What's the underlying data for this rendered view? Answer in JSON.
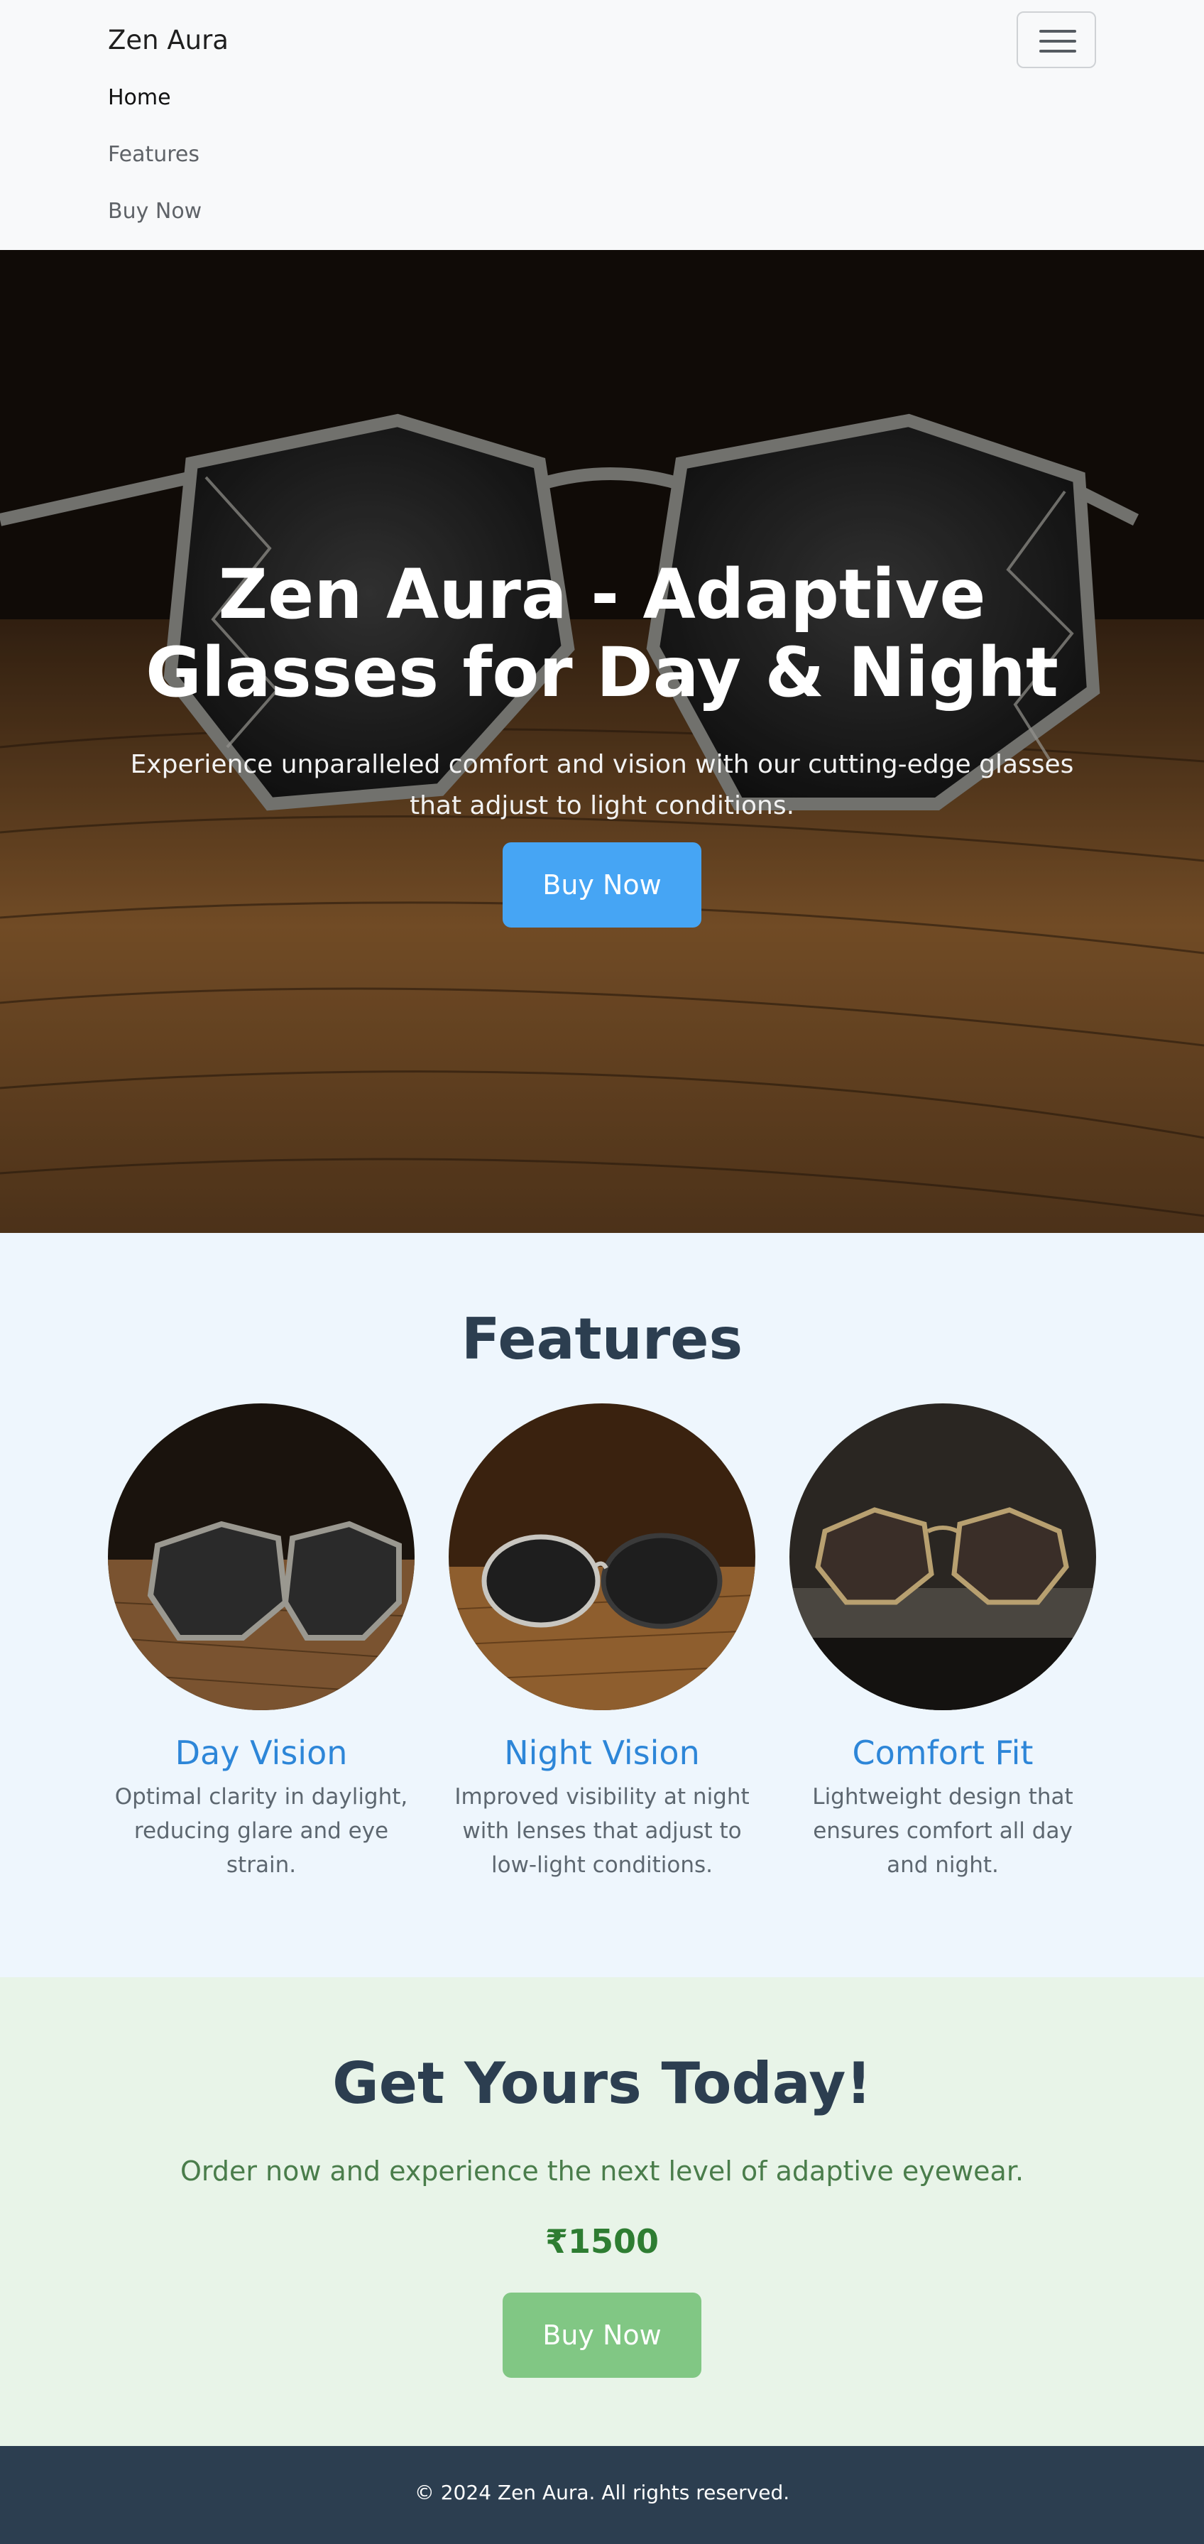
{
  "navbar": {
    "brand": "Zen Aura",
    "toggle_icon": "hamburger-menu-icon",
    "links": [
      {
        "label": "Home",
        "active": true
      },
      {
        "label": "Features",
        "active": false
      },
      {
        "label": "Buy Now",
        "active": false
      }
    ]
  },
  "hero": {
    "title": "Zen Aura - Adaptive Glasses for Day & Night",
    "subtitle": "Experience unparalleled comfort and vision with our cutting-edge glasses that adjust to light conditions.",
    "button_label": "Buy Now",
    "background": "photo of geometric metal-frame sunglasses on a wooden table"
  },
  "features": {
    "title": "Features",
    "items": [
      {
        "name": "Day Vision",
        "description": "Optimal clarity in daylight, reducing glare and eye strain."
      },
      {
        "name": "Night Vision",
        "description": "Improved visibility at night with lenses that adjust to low-light conditions."
      },
      {
        "name": "Comfort Fit",
        "description": "Lightweight design that ensures comfort all day and night."
      }
    ]
  },
  "cta": {
    "title": "Get Yours Today!",
    "subtitle": "Order now and experience the next level of adaptive eyewear.",
    "price": "₹1500",
    "button_label": "Buy Now"
  },
  "footer": {
    "text": "© 2024 Zen Aura. All rights reserved."
  },
  "colors": {
    "primary_button": "#46a5f4",
    "cta_button": "#81c784",
    "feature_heading": "#2d86d8",
    "section_heading": "#2c3e50",
    "price": "#2e7d32",
    "footer_bg": "#2c3e50"
  }
}
